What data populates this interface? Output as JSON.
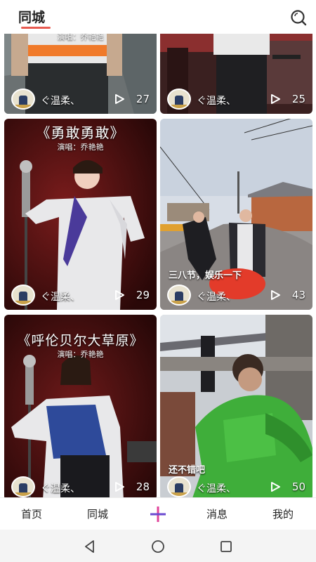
{
  "header": {
    "title": "同城"
  },
  "feed": {
    "cards": [
      {
        "id": "c1",
        "title": "",
        "subtitle": "演唱：乔艳艳",
        "caption": "",
        "user": "ぐ温柔、",
        "views": "27"
      },
      {
        "id": "c2",
        "title": "",
        "subtitle": "",
        "caption": "",
        "user": "ぐ温柔、",
        "views": "25"
      },
      {
        "id": "c3",
        "title": "《勇敢勇敢》",
        "subtitle": "演唱：乔艳艳",
        "caption": "",
        "user": "ぐ温柔、",
        "views": "29"
      },
      {
        "id": "c4",
        "title": "",
        "subtitle": "",
        "caption": "三八节，娱乐一下",
        "user": "ぐ温柔、",
        "views": "43"
      },
      {
        "id": "c5",
        "title": "《呼伦贝尔大草原》",
        "subtitle": "演唱：乔艳艳",
        "caption": "",
        "user": "ぐ温柔、",
        "views": "28"
      },
      {
        "id": "c6",
        "title": "",
        "subtitle": "",
        "caption": "还不错吧",
        "user": "ぐ温柔、",
        "views": "50"
      }
    ]
  },
  "tabbar": {
    "items": [
      {
        "label": "首页"
      },
      {
        "label": "同城"
      },
      {
        "label": "消息"
      },
      {
        "label": "我的"
      }
    ],
    "accent_color": "#e0439a"
  },
  "colors": {
    "header_underline": "#e85a50"
  }
}
